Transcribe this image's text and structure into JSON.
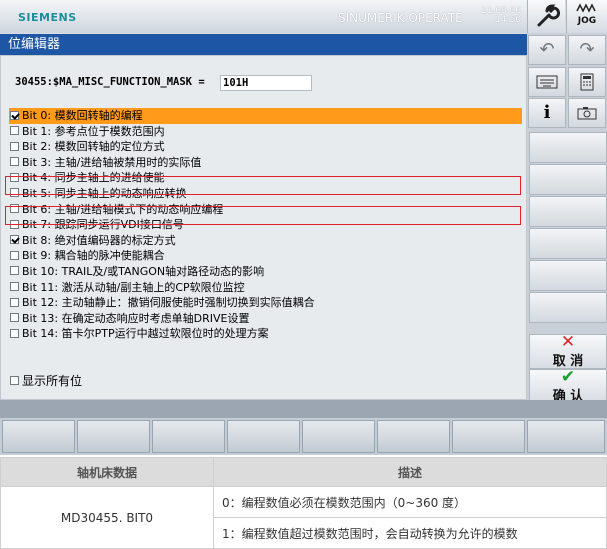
{
  "header": {
    "brand": "SIEMENS",
    "product": "SINUMERIK OPERATE",
    "date": "21.08.06",
    "time": "14:50",
    "jog_label": "JOG"
  },
  "window": {
    "title": "位编辑器",
    "param_label": "30455:$MA_MISC_FUNCTION_MASK = ",
    "param_value": "101H"
  },
  "bits": [
    {
      "label": "Bit 0: 模数回转轴的编程",
      "checked": true,
      "selected": true
    },
    {
      "label": "Bit 1: 参考点位于模数范围内",
      "checked": false
    },
    {
      "label": "Bit 2: 模数回转轴的定位方式",
      "checked": false
    },
    {
      "label": "Bit 3: 主轴/进给轴被禁用时的实际值",
      "checked": false
    },
    {
      "label": "Bit 4: 同步主轴上的进给使能",
      "checked": false
    },
    {
      "label": "Bit 5: 同步主轴上的动态响应转换",
      "checked": false
    },
    {
      "label": "Bit 6: 主轴/进给轴模式下的动态响应编程",
      "checked": false
    },
    {
      "label": "Bit 7: 跟踪同步运行VDI接口信号",
      "checked": false
    },
    {
      "label": "Bit 8: 绝对值编码器的标定方式",
      "checked": true
    },
    {
      "label": "Bit 9: 耦合轴的脉冲使能耦合",
      "checked": false
    },
    {
      "label": "Bit 10: TRAIL及/或TANGON轴对路径动态的影响",
      "checked": false
    },
    {
      "label": "Bit 11: 激活从动轴/副主轴上的CP软限位监控",
      "checked": false
    },
    {
      "label": "Bit 12: 主动轴静止：撤销伺服使能时强制切换到实际值耦合",
      "checked": false
    },
    {
      "label": "Bit 13: 在确定动态响应时考虑单轴DRIVE设置",
      "checked": false
    },
    {
      "label": "Bit 14: 笛卡尔PTP运行中越过软限位时的处理方案",
      "checked": false
    }
  ],
  "show_all_label": "显示所有位",
  "sidebar": {
    "cancel_label": "取 消",
    "confirm_label": "确 认",
    "info_label": "i"
  },
  "table": {
    "headers": [
      "轴机床数据",
      "描述"
    ],
    "param": "MD30455. BIT0",
    "desc": [
      "0：编程数值必须在模数范围内（0~360 度）",
      "1：编程数值超过模数范围时，会自动转换为允许的模数"
    ]
  },
  "colors": {
    "title_bar": "#1d56a4",
    "selection": "#ff9a1a",
    "highlight_box": "#e0242b",
    "brand": "#1b8f9d"
  }
}
